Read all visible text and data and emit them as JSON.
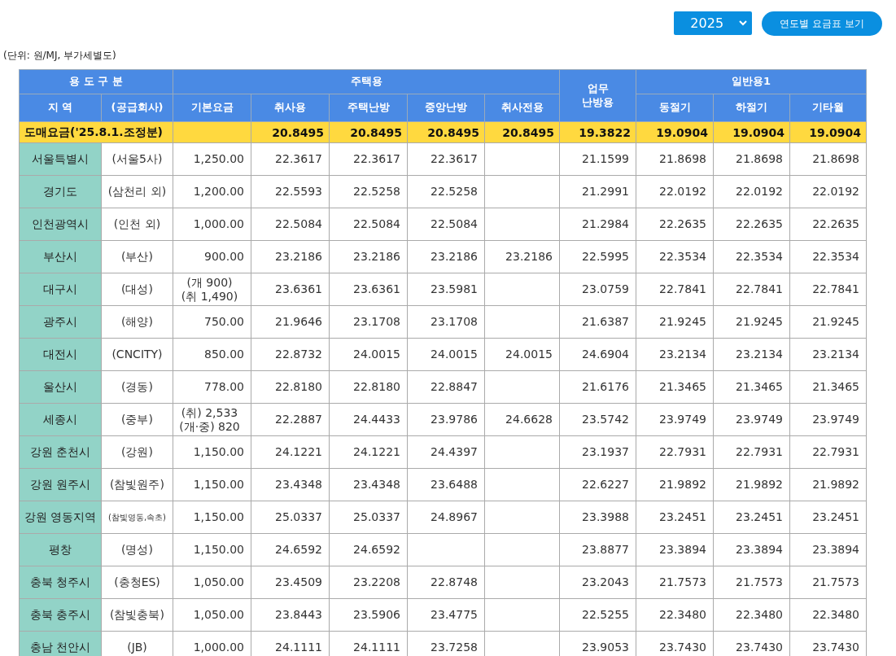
{
  "year_select": {
    "value": "2025"
  },
  "chart_button": {
    "label": "연도별 요금표 보기"
  },
  "unit_note": "(단위: 원/MJ, 부가세별도)",
  "header": {
    "groups": [
      {
        "lines": [
          "용 도 구 분"
        ]
      },
      {
        "lines": [
          "주택용"
        ]
      },
      {
        "lines": [
          "업무",
          "난방용"
        ]
      },
      {
        "lines": [
          "일반용1"
        ]
      }
    ],
    "columns": [
      "지 역",
      "(공급회사)",
      "기본요금",
      "취사용",
      "주택난방",
      "중앙난방",
      "취사전용",
      "동절기",
      "하절기",
      "기타월"
    ]
  },
  "wholesale": {
    "label": "도매요금('25.8.1.조정분)",
    "values": [
      "20.8495",
      "20.8495",
      "20.8495",
      "20.8495",
      "19.3822",
      "19.0904",
      "19.0904",
      "19.0904"
    ]
  },
  "rows": [
    {
      "region": "서울특별시",
      "supplier": "(서울5사)",
      "base": [
        "1,250.00"
      ],
      "rates": {
        "cooking": "22.3617",
        "home_heating": "22.3617",
        "central_heating": "22.3617",
        "business_heating": "21.1599",
        "winter": "21.8698",
        "summer": "21.8698",
        "other": "21.8698"
      }
    },
    {
      "region": "경기도",
      "supplier": "(삼천리 외)",
      "base": [
        "1,200.00"
      ],
      "rates": {
        "cooking": "22.5593",
        "home_heating": "22.5258",
        "central_heating": "22.5258",
        "business_heating": "21.2991",
        "winter": "22.0192",
        "summer": "22.0192",
        "other": "22.0192"
      }
    },
    {
      "region": "인천광역시",
      "supplier": "(인천 외)",
      "base": [
        "1,000.00"
      ],
      "rates": {
        "cooking": "22.5084",
        "home_heating": "22.5084",
        "central_heating": "22.5084",
        "business_heating": "21.2984",
        "winter": "22.2635",
        "summer": "22.2635",
        "other": "22.2635"
      }
    },
    {
      "region": "부산시",
      "supplier": "(부산)",
      "base": [
        "900.00"
      ],
      "rates": {
        "cooking": "23.2186",
        "home_heating": "23.2186",
        "central_heating": "23.2186",
        "cooking_only": "23.2186",
        "business_heating": "22.5995",
        "winter": "22.3534",
        "summer": "22.3534",
        "other": "22.3534"
      }
    },
    {
      "region": "대구시",
      "supplier": "(대성)",
      "base": [
        "(개 900)",
        "(취 1,490)"
      ],
      "rates": {
        "cooking": "23.6361",
        "home_heating": "23.6361",
        "central_heating": "23.5981",
        "business_heating": "23.0759",
        "winter": "22.7841",
        "summer": "22.7841",
        "other": "22.7841"
      }
    },
    {
      "region": "광주시",
      "supplier": "(해양)",
      "base": [
        "750.00"
      ],
      "rates": {
        "cooking": "21.9646",
        "home_heating": "23.1708",
        "central_heating": "23.1708",
        "business_heating": "21.6387",
        "winter": "21.9245",
        "summer": "21.9245",
        "other": "21.9245"
      }
    },
    {
      "region": "대전시",
      "supplier": "(CNCITY)",
      "base": [
        "850.00"
      ],
      "rates": {
        "cooking": "22.8732",
        "home_heating": "24.0015",
        "central_heating": "24.0015",
        "cooking_only": "24.0015",
        "business_heating": "24.6904",
        "winter": "23.2134",
        "summer": "23.2134",
        "other": "23.2134"
      }
    },
    {
      "region": "울산시",
      "supplier": "(경동)",
      "base": [
        "778.00"
      ],
      "rates": {
        "cooking": "22.8180",
        "home_heating": "22.8180",
        "central_heating": "22.8847",
        "business_heating": "21.6176",
        "winter": "21.3465",
        "summer": "21.3465",
        "other": "21.3465"
      }
    },
    {
      "region": "세종시",
      "supplier": "(중부)",
      "base": [
        "(취) 2,533",
        "(개·중) 820"
      ],
      "rates": {
        "cooking": "22.2887",
        "home_heating": "24.4433",
        "central_heating": "23.9786",
        "cooking_only": "24.6628",
        "business_heating": "23.5742",
        "winter": "23.9749",
        "summer": "23.9749",
        "other": "23.9749"
      }
    },
    {
      "region": "강원 춘천시",
      "supplier": "(강원)",
      "base": [
        "1,150.00"
      ],
      "rates": {
        "cooking": "24.1221",
        "home_heating": "24.1221",
        "central_heating": "24.4397",
        "business_heating": "23.1937",
        "winter": "22.7931",
        "summer": "22.7931",
        "other": "22.7931"
      }
    },
    {
      "region": "강원 원주시",
      "supplier": "(참빛원주)",
      "base": [
        "1,150.00"
      ],
      "rates": {
        "cooking": "23.4348",
        "home_heating": "23.4348",
        "central_heating": "23.6488",
        "business_heating": "22.6227",
        "winter": "21.9892",
        "summer": "21.9892",
        "other": "21.9892"
      }
    },
    {
      "region": "강원 영동지역",
      "supplier": "(참빛영동,속초)",
      "small_supplier": true,
      "base": [
        "1,150.00"
      ],
      "rates": {
        "cooking": "25.0337",
        "home_heating": "25.0337",
        "central_heating": "24.8967",
        "business_heating": "23.3988",
        "winter": "23.2451",
        "summer": "23.2451",
        "other": "23.2451"
      }
    },
    {
      "region": "평창",
      "supplier": "(명성)",
      "base": [
        "1,150.00"
      ],
      "rates": {
        "cooking": "24.6592",
        "home_heating": "24.6592",
        "business_heating": "23.8877",
        "winter": "23.3894",
        "summer": "23.3894",
        "other": "23.3894"
      }
    },
    {
      "region": "충북 청주시",
      "supplier": "(충청ES)",
      "base": [
        "1,050.00"
      ],
      "rates": {
        "cooking": "23.4509",
        "home_heating": "23.2208",
        "central_heating": "22.8748",
        "business_heating": "23.2043",
        "winter": "21.7573",
        "summer": "21.7573",
        "other": "21.7573"
      }
    },
    {
      "region": "충북 충주시",
      "supplier": "(참빛충북)",
      "base": [
        "1,050.00"
      ],
      "rates": {
        "cooking": "23.8443",
        "home_heating": "23.5906",
        "central_heating": "23.4775",
        "business_heating": "22.5255",
        "winter": "22.3480",
        "summer": "22.3480",
        "other": "22.3480"
      }
    },
    {
      "region": "충남 천안시",
      "supplier": "(JB)",
      "base": [
        "1,000.00"
      ],
      "rates": {
        "cooking": "24.1111",
        "home_heating": "24.1111",
        "central_heating": "23.7258",
        "business_heating": "23.9053",
        "winter": "23.7430",
        "summer": "23.7430",
        "other": "23.7430"
      }
    }
  ]
}
